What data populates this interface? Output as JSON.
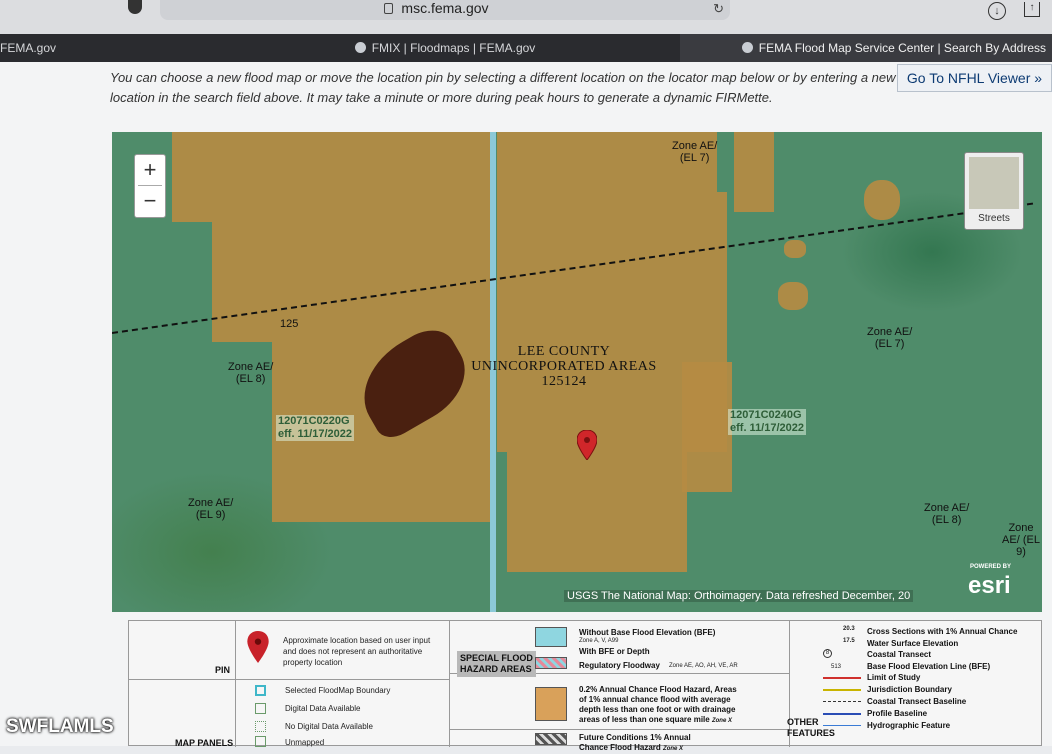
{
  "browser": {
    "url": "msc.fema.gov",
    "tabs": [
      {
        "label": "FEMA.gov"
      },
      {
        "label": "FMIX | Floodmaps | FEMA.gov"
      },
      {
        "label": "FEMA Flood Map Service Center | Search By Address"
      }
    ]
  },
  "page": {
    "instructions": "You can choose a new flood map or move the location pin by selecting a different location on the locator map below or by entering a new location in the search field above. It may take a minute or more during peak hours to generate a dynamic FIRMette.",
    "nfhl_button": "Go To NFHL Viewer »"
  },
  "map": {
    "zoom_in": "+",
    "zoom_out": "−",
    "basemap_label": "Streets",
    "area_lines": [
      "LEE COUNTY",
      "UNINCORPORATED AREAS",
      "125124"
    ],
    "cross_section": "125",
    "zones": [
      {
        "line1": "Zone AE/",
        "line2": "(EL 7)"
      },
      {
        "line1": "Zone AE/",
        "line2": "(EL 7)"
      },
      {
        "line1": "Zone AE/",
        "line2": "(EL 8)"
      },
      {
        "line1": "Zone AE/",
        "line2": "(EL 9)"
      },
      {
        "line1": "Zone AE/",
        "line2": "(EL 8)"
      },
      {
        "line1": "Zone",
        "line2": "AE/ (EL 9)"
      }
    ],
    "panels": [
      {
        "id": "12071C0220G",
        "eff": "eff. 11/17/2022"
      },
      {
        "id": "12071C0240G",
        "eff": "eff. 11/17/2022"
      }
    ],
    "credit": "USGS The National Map: Orthoimagery. Data refreshed December, 20",
    "powered_by": "POWERED BY",
    "esri": "esri"
  },
  "legend": {
    "pin_label": "PIN",
    "pin_text": [
      "Approximate location based on user input",
      "and does not represent an authoritative",
      "property location"
    ],
    "panel_items": [
      "Selected FloodMap Boundary",
      "Digital Data Available",
      "No Digital Data Available",
      "Unmapped"
    ],
    "map_panels_label": "MAP PANELS",
    "sfha_label": [
      "SPECIAL FLOOD",
      "HAZARD AREAS"
    ],
    "sfha_items": [
      {
        "title": "Without Base Flood Elevation (BFE)",
        "sub": "Zone A, V, A99"
      },
      {
        "title": "With BFE or Depth",
        "sub": ""
      },
      {
        "title": "Regulatory Floodway",
        "sub": "Zone AE, AO, AH, VE, AR"
      }
    ],
    "other_lines": [
      "0.2% Annual Chance Flood Hazard, Areas",
      "of 1% annual chance flood with average",
      "depth less than one foot or with drainage",
      "areas of less than one square mile"
    ],
    "other_zone": "Zone X",
    "future": [
      "Future Conditions 1% Annual",
      "Chance Flood Hazard"
    ],
    "future_zone": "Zone X",
    "features_label": [
      "OTHER",
      "FEATURES"
    ],
    "features": [
      {
        "symbol": "20.3",
        "text": "Cross Sections with 1% Annual Chance"
      },
      {
        "symbol": "17.5",
        "text": "Water Surface Elevation"
      },
      {
        "symbol": "8",
        "text": "Coastal Transect"
      },
      {
        "symbol": "513",
        "text": "Base Flood Elevation Line (BFE)"
      },
      {
        "symbol": "",
        "text": "Limit of Study"
      },
      {
        "symbol": "",
        "text": "Jurisdiction Boundary"
      },
      {
        "symbol": "",
        "text": "Coastal Transect Baseline"
      },
      {
        "symbol": "",
        "text": "Profile Baseline"
      },
      {
        "symbol": "",
        "text": "Hydrographic Feature"
      }
    ]
  },
  "watermark": "SWFLAMLS",
  "colors": {
    "hazard": "#b58b43",
    "road": "#8cc9d8",
    "lake": "#4a2010",
    "limit_of_study": "#d0312d",
    "jurisdiction": "#c9b400",
    "profile": "#2a4db5"
  }
}
